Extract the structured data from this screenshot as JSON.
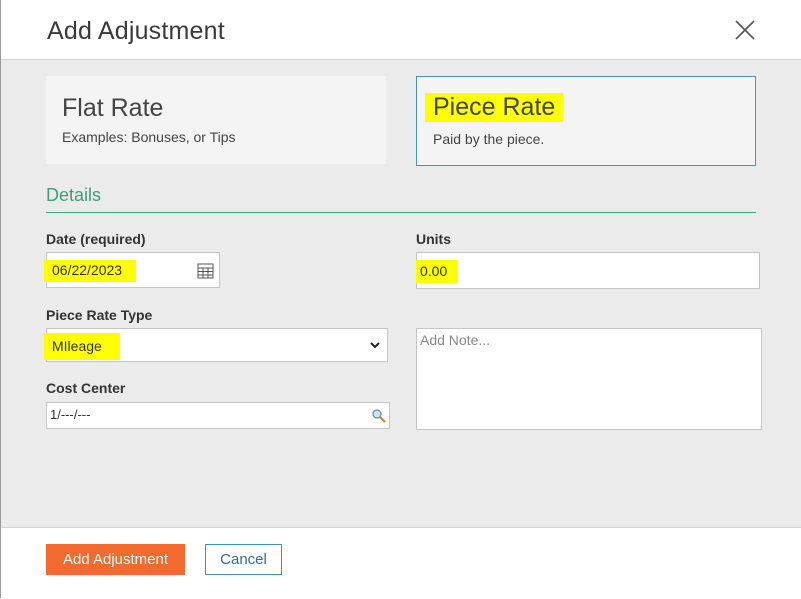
{
  "dialog": {
    "title": "Add Adjustment"
  },
  "cards": {
    "flat": {
      "title": "Flat Rate",
      "subtitle": "Examples: Bonuses, or Tips"
    },
    "piece": {
      "title": "Piece Rate",
      "subtitle": "Paid by the piece.",
      "selected": true
    }
  },
  "details": {
    "section_title": "Details",
    "date": {
      "label": "Date (required)",
      "value": "06/22/2023"
    },
    "units": {
      "label": "Units",
      "value": "0.00"
    },
    "piece_rate_type": {
      "label": "Piece Rate Type",
      "value": "MIleage"
    },
    "note": {
      "placeholder": "Add Note..."
    },
    "cost_center": {
      "label": "Cost Center",
      "value": "1/---/---"
    }
  },
  "footer": {
    "primary_label": "Add Adjustment",
    "secondary_label": "Cancel"
  },
  "colors": {
    "accent_orange": "#f26a2e",
    "accent_blue": "#4a8fb5",
    "section_green": "#3f9f76",
    "highlight": "#ffff00"
  },
  "icons": {
    "close": "close-icon",
    "calendar": "calendar-icon",
    "select": "chevron-down-icon",
    "search": "search-icon"
  }
}
